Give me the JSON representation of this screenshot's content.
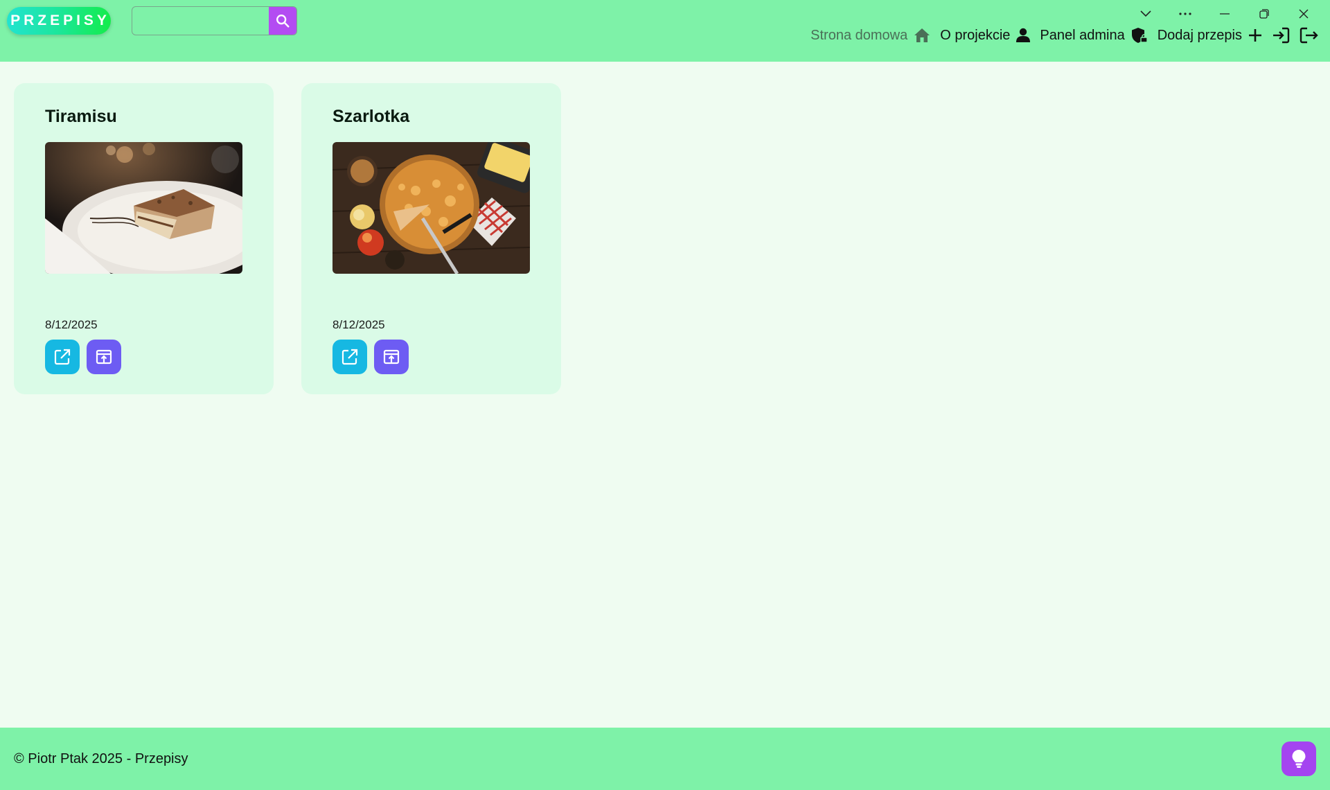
{
  "header": {
    "logo_text": "PRZEPISY",
    "search": {
      "placeholder": "",
      "value": ""
    },
    "nav": {
      "home": "Strona domowa",
      "about": "O projekcie",
      "admin": "Panel admina",
      "add_recipe": "Dodaj przepis"
    },
    "icons": [
      "chevron-down-icon",
      "more-icon",
      "minimize-icon",
      "restore-icon",
      "close-icon",
      "home-icon",
      "user-icon",
      "shield-lock-icon",
      "plus-icon",
      "login-icon",
      "logout-icon",
      "search-icon"
    ]
  },
  "recipes": [
    {
      "title": "Tiramisu",
      "date": "8/12/2025",
      "image": "tiramisu-photo"
    },
    {
      "title": "Szarlotka",
      "date": "8/12/2025",
      "image": "apple-pie-photo"
    }
  ],
  "footer": {
    "text": "© Piotr Ptak 2025 - Przepisy"
  },
  "colors": {
    "header_bg": "#7ef2a8",
    "page_bg": "#effcf1",
    "card_bg": "#dafbe7",
    "search_button": "#b34cf2",
    "edit_button": "#16b8e2",
    "publish_button": "#6d5cf3",
    "idea_button": "#a444f0"
  }
}
